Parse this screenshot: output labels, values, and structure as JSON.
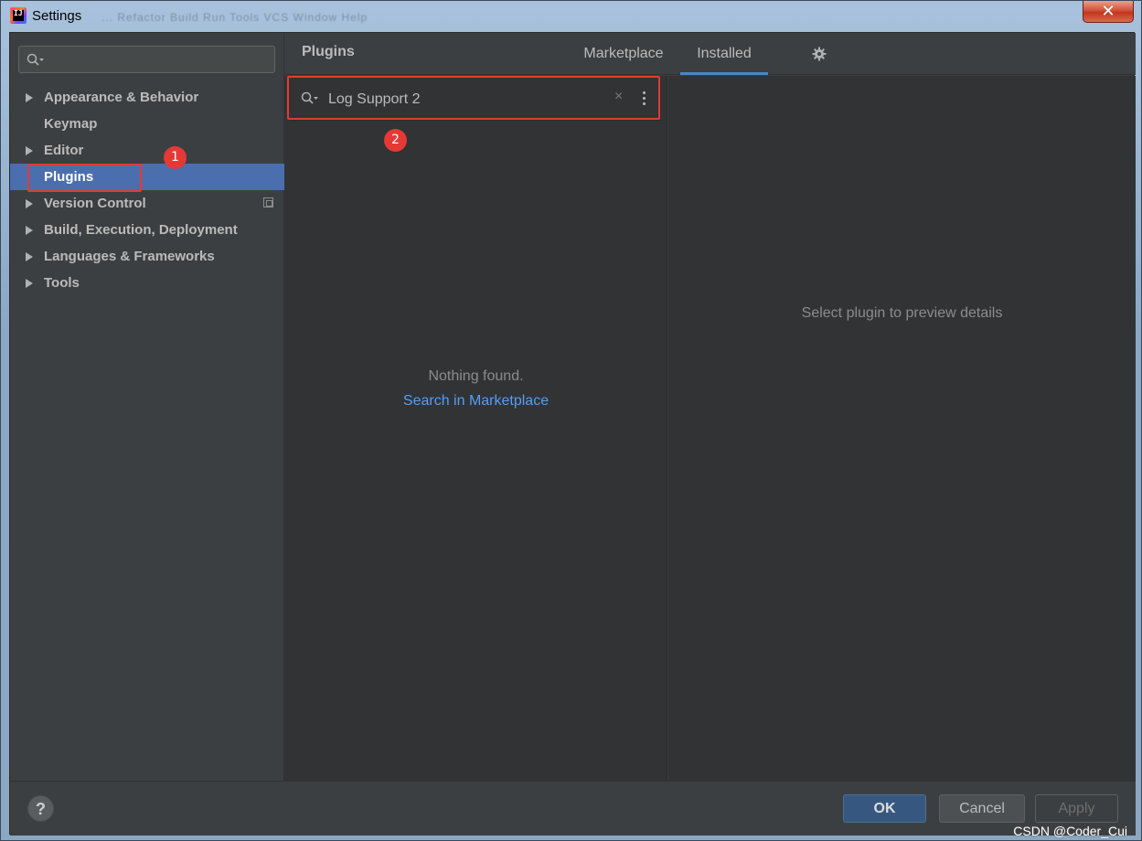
{
  "window": {
    "title": "Settings",
    "close_glyph": "✕",
    "blurred_menu": "...   Refactor   Build   Run   Tools   VCS   Window   Help"
  },
  "sidebar": {
    "search_placeholder": "",
    "items": [
      {
        "label": "Appearance & Behavior",
        "expandable": true
      },
      {
        "label": "Keymap",
        "expandable": false
      },
      {
        "label": "Editor",
        "expandable": true
      },
      {
        "label": "Plugins",
        "expandable": false,
        "selected": true
      },
      {
        "label": "Version Control",
        "expandable": true
      },
      {
        "label": "Build, Execution, Deployment",
        "expandable": true
      },
      {
        "label": "Languages & Frameworks",
        "expandable": true
      },
      {
        "label": "Tools",
        "expandable": true
      }
    ]
  },
  "header": {
    "title": "Plugins",
    "tabs": [
      {
        "label": "Marketplace",
        "active": false
      },
      {
        "label": "Installed",
        "active": true
      }
    ]
  },
  "plugin_search": {
    "value": "Log Support 2",
    "clear_glyph": "×"
  },
  "plugin_list": {
    "empty_text": "Nothing found.",
    "marketplace_link": "Search in Marketplace"
  },
  "details": {
    "hint": "Select plugin to preview details"
  },
  "footer": {
    "help": "?",
    "ok": "OK",
    "cancel": "Cancel",
    "apply": "Apply"
  },
  "annotations": {
    "marker_1": "1",
    "marker_2": "2",
    "color": "#e53935"
  },
  "watermark": "CSDN @Coder_Cui",
  "colors": {
    "selection": "#4b6eaf",
    "link": "#589df6",
    "tab_underline": "#4a88c7"
  }
}
